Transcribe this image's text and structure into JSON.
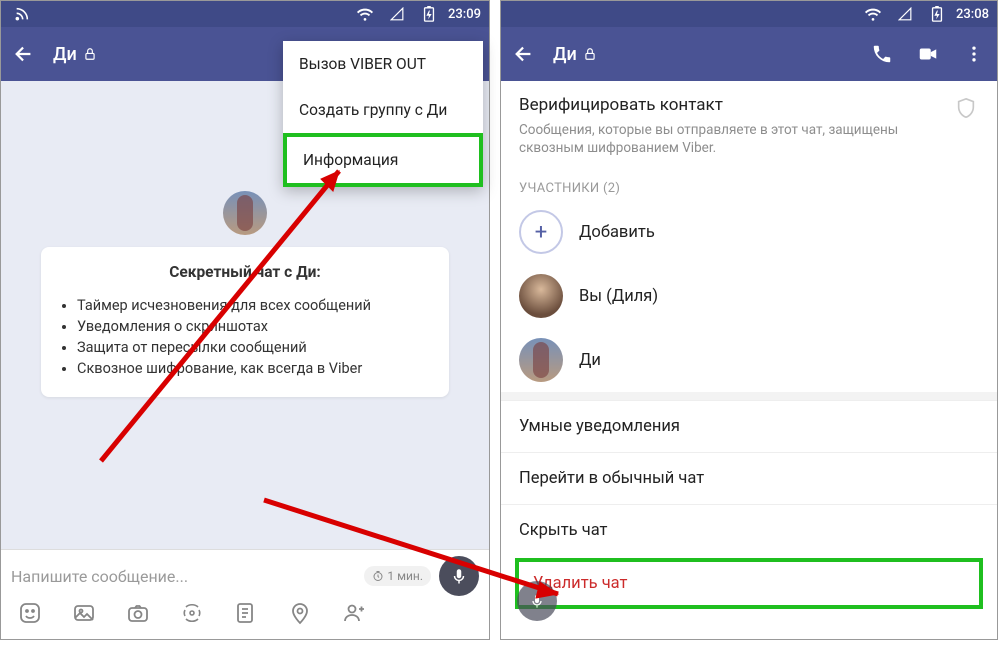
{
  "statusbar": {
    "time_left": "23:09",
    "time_right": "23:08"
  },
  "appbar": {
    "title": "Ди"
  },
  "dropdown": {
    "viber_out": "Вызов VIBER OUT",
    "create_group": "Создать группу с Ди",
    "information": "Информация"
  },
  "chat_card": {
    "title": "Секретный чат с Ди:",
    "bullets": [
      "Таймер исчезновения для всех сообщений",
      "Уведомления о скриншотах",
      "Защита от пересылки сообщений",
      "Сквозное шифрование, как всегда в Viber"
    ]
  },
  "composer": {
    "placeholder": "Напишите сообщение...",
    "timer": "1 мин."
  },
  "info": {
    "verify_title": "Верифицировать контакт",
    "verify_sub": "Сообщения, которые вы отправляете в этот чат, защищены сквозным шифрованием Viber.",
    "participants_label": "УЧАСТНИКИ (2)",
    "add": "Добавить",
    "you": "Вы (Диля)",
    "other": "Ди",
    "smart_notifications": "Умные уведомления",
    "to_normal": "Перейти в обычный чат",
    "hide_chat": "Скрыть чат",
    "delete_chat": "Удалить чат"
  }
}
